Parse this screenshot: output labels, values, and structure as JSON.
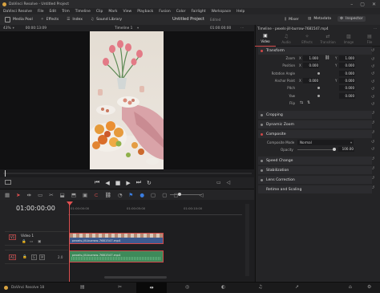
{
  "titlebar": {
    "title": "DaVinci Resolve - Untitled Project"
  },
  "menu": [
    "DaVinci Resolve",
    "File",
    "Edit",
    "Trim",
    "Timeline",
    "Clip",
    "Mark",
    "View",
    "Playback",
    "Fusion",
    "Color",
    "Fairlight",
    "Workspace",
    "Help"
  ],
  "toolbar": {
    "media_pool": "Media Pool",
    "effects": "Effects",
    "index": "Index",
    "sound_library": "Sound Library",
    "project_title": "Untitled Project",
    "edited": "Edited",
    "mixer": "Mixer",
    "metadata": "Metadata",
    "inspector": "Inspector"
  },
  "viewer_bar": {
    "zoom": "43%",
    "left_tc": "00:00:13:09",
    "timeline_name": "Timeline 1",
    "right_tc": "01:00:00:00"
  },
  "inspector": {
    "header": "Timeline - pexels-jill-burrow-7681547.mp4",
    "tabs": [
      "Video",
      "Audio",
      "Effects",
      "Transition",
      "Image",
      "File"
    ],
    "sections": {
      "transform": "Transform",
      "cropping": "Cropping",
      "dynamic_zoom": "Dynamic Zoom",
      "composite": "Composite",
      "speed_change": "Speed Change",
      "stabilization": "Stabilization",
      "lens_correction": "Lens Correction",
      "retime": "Retime and Scaling"
    },
    "transform_rows": [
      {
        "label": "Zoom",
        "a": "X",
        "av": "1.000",
        "b": "Y",
        "bv": "1.000",
        "link": true
      },
      {
        "label": "Position",
        "a": "X",
        "av": "0.000",
        "b": "Y",
        "bv": "0.000",
        "link": false
      },
      {
        "label": "Rotation Angle",
        "a": "",
        "av": "",
        "b": "",
        "bv": "0.000",
        "link": false
      },
      {
        "label": "Anchor Point",
        "a": "X",
        "av": "0.000",
        "b": "Y",
        "bv": "0.000",
        "link": false
      },
      {
        "label": "Pitch",
        "a": "",
        "av": "",
        "b": "",
        "bv": "0.000",
        "link": false
      },
      {
        "label": "Yaw",
        "a": "",
        "av": "",
        "b": "",
        "bv": "0.000",
        "link": false
      },
      {
        "label": "Flip",
        "a": "",
        "av": "",
        "b": "",
        "bv": "",
        "link": false
      }
    ],
    "composite_mode_label": "Composite Mode",
    "composite_mode_value": "Normal",
    "opacity_label": "Opacity",
    "opacity_value": "100.00",
    "opacity_level": 1.0
  },
  "timeline": {
    "timecode": "01:00:00:00",
    "ruler": [
      "01:00:00:00",
      "01:00:05:00",
      "01:00:10:00"
    ],
    "video_track": {
      "id": "V1",
      "name": "Video 1",
      "clip": "pexels-jill-burrow-7681547.mp4"
    },
    "audio_track": {
      "id": "A1",
      "gain": "2.0",
      "clip": "pexels-jill-burrow-7681547.mp4"
    }
  },
  "bottom": {
    "app": "DaVinci Resolve 18"
  },
  "colors": {
    "accent_red": "#d04848",
    "video_clip": "#3d5a8f",
    "audio_clip": "#3e8a5a",
    "playhead": "#e05050"
  }
}
